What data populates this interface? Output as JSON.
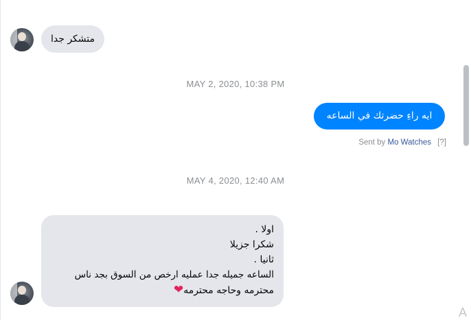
{
  "messages": {
    "first_incoming": "متشكر جدا",
    "timestamp_1": "MAY 2, 2020, 10:38 PM",
    "outgoing": "ايه راءِ حضرتك في الساعه",
    "sent_by": {
      "prefix": "Sent by",
      "name": "Mo Watches",
      "help": "[?]"
    },
    "timestamp_2": "MAY 4, 2020, 12:40 AM",
    "long_incoming_lines": [
      "اولا .",
      "شكرا جزيلا",
      "ثانيا .",
      "الساعه جميله جدا عمليه ارخص من السوق بجد ناس",
      "محترمه وحاجه محترمه"
    ],
    "heart_icon": "red-heart"
  },
  "corner_fragment": "A",
  "colors": {
    "outgoing_bubble": "#0084ff",
    "incoming_bubble": "#e4e6eb",
    "timestamp": "#8a8d91",
    "sender_link": "#385898"
  }
}
